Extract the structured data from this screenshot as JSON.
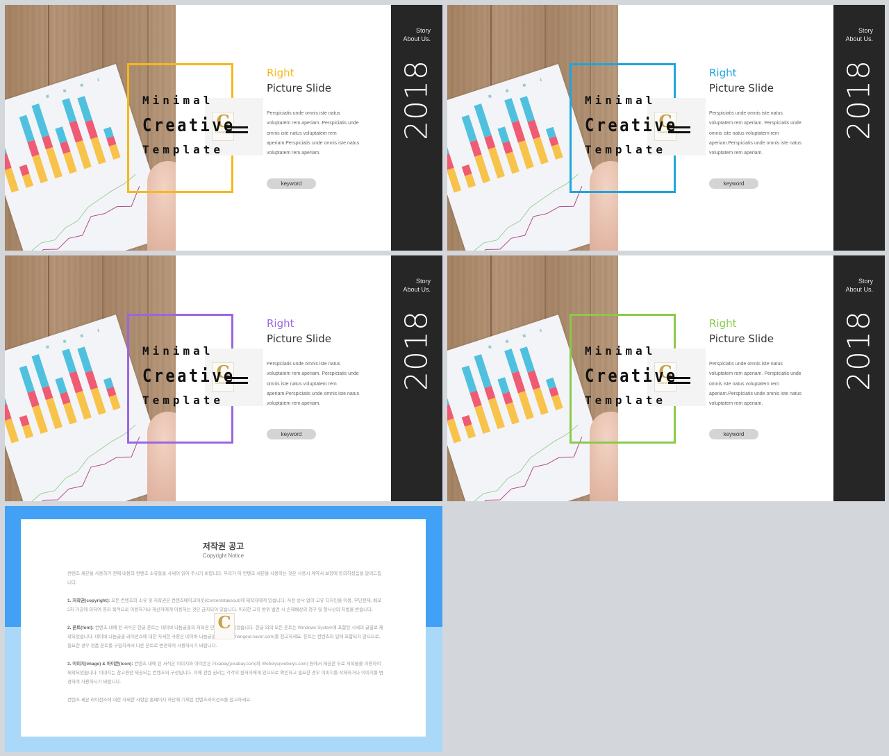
{
  "slides": [
    {
      "accent": "#f5b81c",
      "title": {
        "line1": "Minimal",
        "line2": "Creative",
        "line3": "Template"
      },
      "right_title": "Right",
      "right_subtitle": "Picture Slide",
      "body": "Perspiciatis unde omnis iste natus voluptatem rem aperiam. Perspiciatis unde omnis iste natus voluptatem rem aperiam.Perspiciatis unde omnis iste natus voluptatem rem aperiam.",
      "keyword": "keyword",
      "story": "Story",
      "about": "About Us.",
      "year": "2018",
      "logo_letter": "C",
      "logo_text": "CONTENTS"
    },
    {
      "accent": "#1ea5de",
      "title": {
        "line1": "Minimal",
        "line2": "Creative",
        "line3": "Template"
      },
      "right_title": "Right",
      "right_subtitle": "Picture Slide",
      "body": "Perspiciatis unde omnis iste natus voluptatem rem aperiam. Perspiciatis unde omnis iste natus voluptatem rem aperiam.Perspiciatis unde omnis iste natus voluptatem rem aperiam.",
      "keyword": "keyword",
      "story": "Story",
      "about": "About Us.",
      "year": "2018",
      "logo_letter": "C",
      "logo_text": "CONTENTS"
    },
    {
      "accent": "#9a66e0",
      "title": {
        "line1": "Minimal",
        "line2": "Creative",
        "line3": "Template"
      },
      "right_title": "Right",
      "right_subtitle": "Picture Slide",
      "body": "Perspiciatis unde omnis iste natus voluptatem rem aperiam. Perspiciatis unde omnis iste natus voluptatem rem aperiam.Perspiciatis unde omnis iste natus voluptatem rem aperiam.",
      "keyword": "keyword",
      "story": "Story",
      "about": "About Us.",
      "year": "2018",
      "logo_letter": "C",
      "logo_text": "CONTENTS"
    },
    {
      "accent": "#8bc94a",
      "title": {
        "line1": "Minimal",
        "line2": "Creative",
        "line3": "Template"
      },
      "right_title": "Right",
      "right_subtitle": "Picture Slide",
      "body": "Perspiciatis unde omnis iste natus voluptatem rem aperiam. Perspiciatis unde omnis iste natus voluptatem rem aperiam.Perspiciatis unde omnis iste natus voluptatem rem aperiam.",
      "keyword": "keyword",
      "story": "Story",
      "about": "About Us.",
      "year": "2018",
      "logo_letter": "C",
      "logo_text": "CONTENTS"
    }
  ],
  "copyright": {
    "title": "저작권 공고",
    "subtitle": "Copyright Notice",
    "intro": "컨텐츠 세븐을 사용하기 전에 내용의 컨텐츠 소유들을 사세이 읽어 주시기 바랍니다. 우리가 이 컨텐츠 세븐을 사용하는 것은 사용시 계약서 보장에 동의하셨음을 알려드립니다.",
    "items": [
      {
        "heading": "1. 저작권(copyright):",
        "text": "모든 컨텐츠의 소유 및 저작권은 컨텐츠메이크어웃(Contentstakeout)에 제작자에게 있습니다. 사전 승낙 없이 고유 디자인을 이용, 무단전재, 배포 2차 가공에 의하여 영리 목적으로 이용하거나 재산자에게 이용하는 것은 금지되어 있습니다. 이러한 고유 방위 발견 시 손해배상의 청구 및 형사상의 처벌을 받습니다."
      },
      {
        "heading": "2. 폰트(font):",
        "text": "컨텐츠 내에 된 서식은 한글 폰트는 네이버 나눔글꼴의 저작권 안에서 제작되었습니다. 한글 외의 모든 폰트는 Windows System에 포함된 시세의 글꼴로 제작되었습니다. 네이버 나눔글꼴 라이선스에 대한 자세한 사항은 네이버 나눔글꼴 홈페이지(hangeul.naver.com)를 참고하세요. 폰트는 컨텐츠의 일에 포함되지 않으므로, 필요한 경우 정품 폰트를 구입하셔서 다른 폰트로 변경하여 사용하시기 바랍니다."
      },
      {
        "heading": "3. 이미지(image) & 아이콘(icon):",
        "text": "컨텐츠 내에 된 서식은 이미지와 아이콘은 Pixabay(pixabay.com)와 Webolys(webolys.com) 등에서 제공한 무료 저작물을 이용하여 제작되었습니다. 이미지는 참고용만 제공되는 컨텐츠의 구성입니다. 이에 관련 권리는 각각의 원저자에게 있으므로 확인하고 필요한 경우 이미지를 삭제하거나 이미지를 변경하여 사용하시기 바랍니다."
      }
    ],
    "footer": "컨텐츠 세븐 라이선스에 대한 자세한 사항은 홈페이지 하단에 기재된 컨텐츠라이선스를 참고하세요."
  }
}
